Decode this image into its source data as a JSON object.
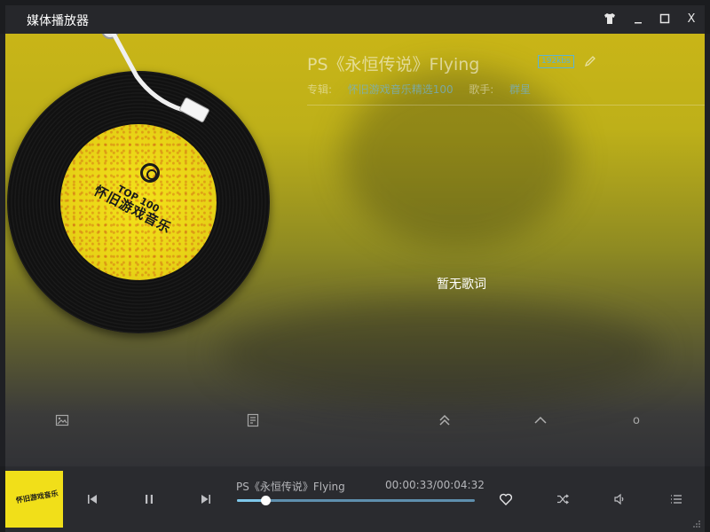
{
  "window": {
    "title": "媒体播放器",
    "icons": [
      "skin-icon",
      "minimize-icon",
      "maximize-icon",
      "close-icon"
    ],
    "close_label": "X"
  },
  "song": {
    "title": "PS《永恒传说》Flying",
    "quality": "192kbs",
    "album_label": "专辑:",
    "album": "怀旧游戏音乐精选100",
    "artist_label": "歌手:",
    "artist": "群星"
  },
  "lyrics": {
    "empty_text": "暂无歌词"
  },
  "disc": {
    "label_line1": "TOP 100",
    "label_line2": "怀旧游戏音乐"
  },
  "toolbar": {
    "icons": [
      "image-icon",
      "lyrics-file-icon",
      "double-chevron-up-icon",
      "chevron-up-icon",
      "circle-icon"
    ],
    "circle_label": "o"
  },
  "player": {
    "now_playing": "PS《永恒传说》Flying",
    "time": "00:00:33/00:04:32",
    "progress": 0.12,
    "cover_text": "怀旧游戏音乐",
    "controls": [
      "previous-icon",
      "pause-icon",
      "next-icon"
    ],
    "actions": [
      "heart-icon",
      "shuffle-icon",
      "volume-icon",
      "playlist-icon"
    ]
  },
  "colors": {
    "accent": "#7ec7ea",
    "background_top": "#c9b517",
    "background_bottom": "#313236",
    "cover_yellow": "#f1df19"
  }
}
